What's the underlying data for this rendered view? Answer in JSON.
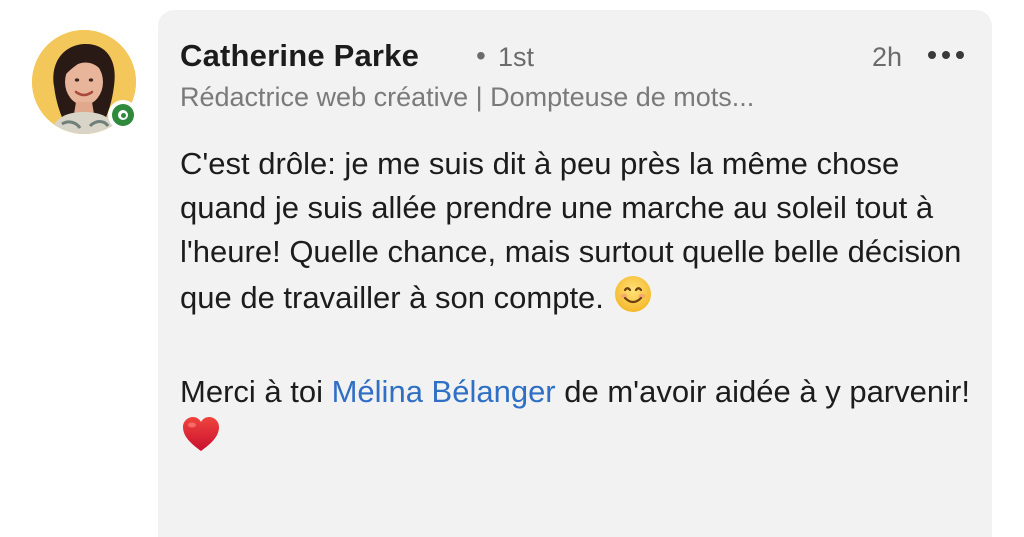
{
  "comment": {
    "author": {
      "name": "Catherine Parke",
      "separator": "•",
      "connection_degree": "1st",
      "headline": "Rédactrice web créative | Dompteuse de mots...",
      "avatar_icon": "profile-photo",
      "online_status": "open-to-work-green"
    },
    "timestamp": "2h",
    "more_icon": "more-horizontal-icon",
    "body": {
      "paragraph_1": "C'est drôle: je me suis dit à peu près la même chose quand je suis allée prendre une marche au soleil tout à l'heure! Quelle chance, mais surtout quelle belle décision que de travailler à son compte.",
      "paragraph_1_emoji": "smiling-face-icon",
      "paragraph_2_before": "Merci à toi ",
      "mention": "Mélina Bélanger",
      "paragraph_2_after": " de m'avoir aidée à y parvenir!",
      "paragraph_2_emoji": "red-heart-icon"
    }
  },
  "colors": {
    "bubble_bg": "#f2f2f2",
    "text": "#1c1c1c",
    "muted": "#6b6b6b",
    "mention": "#2f6fc4",
    "presence": "#2f8a3e",
    "avatar_bg": "#f3c75a"
  }
}
